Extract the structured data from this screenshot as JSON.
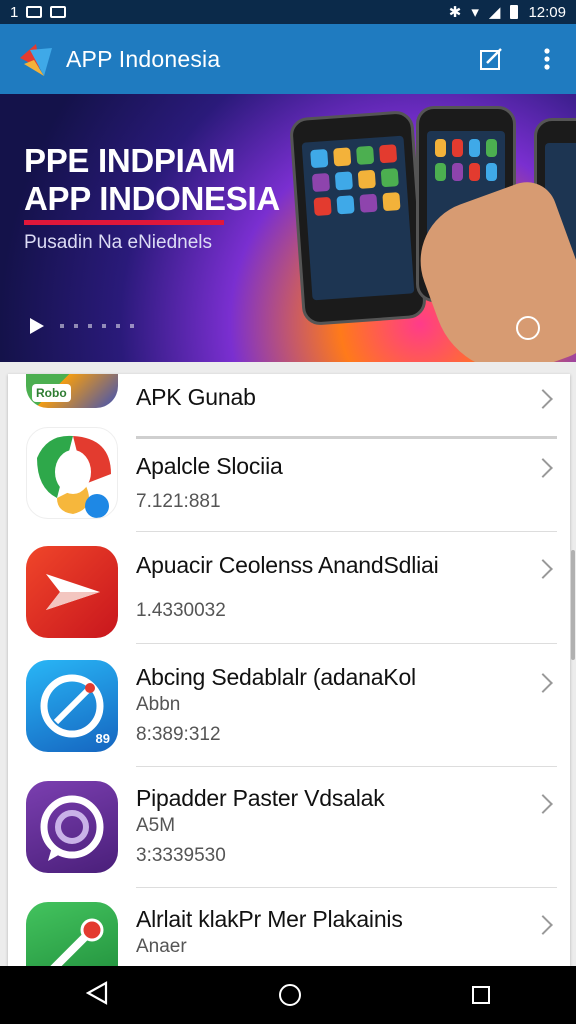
{
  "status_bar": {
    "left_text": "1",
    "time": "12:09"
  },
  "app_bar": {
    "title": "APP Indonesia",
    "icons": [
      "app-logo-icon",
      "edit-square-icon",
      "overflow-menu-icon"
    ]
  },
  "banner": {
    "headline_line1": "PPE INDPIAM",
    "headline_line2": "APP INDONESIA",
    "subtitle": "Pusadin Na eNiednels"
  },
  "list": {
    "items": [
      {
        "name": "APK Gunab",
        "icon_label": "Robo",
        "meta1": "",
        "meta2": ""
      },
      {
        "name": "Apalcle Slociia",
        "meta1": "7.121:881",
        "meta2": ""
      },
      {
        "name": "Apuacir Ceolenss AnandSdliai",
        "meta1": "",
        "meta2": "1.4330032"
      },
      {
        "name": "Abcing Sedablalr (adanaKol",
        "icon_label": "89",
        "meta1": "Abbn",
        "meta2": "8:389:312"
      },
      {
        "name": "Pipadder Paster Vdsalak",
        "meta1": "A5M",
        "meta2": "3:3339530"
      },
      {
        "name": "Alrlait klakPr Mer Plakainis",
        "meta1": "Anaer",
        "meta2": ""
      }
    ]
  },
  "colors": {
    "app_bar": "#1f7bc0",
    "status_bar": "#0b2a4a",
    "nav_bar": "#000000"
  }
}
